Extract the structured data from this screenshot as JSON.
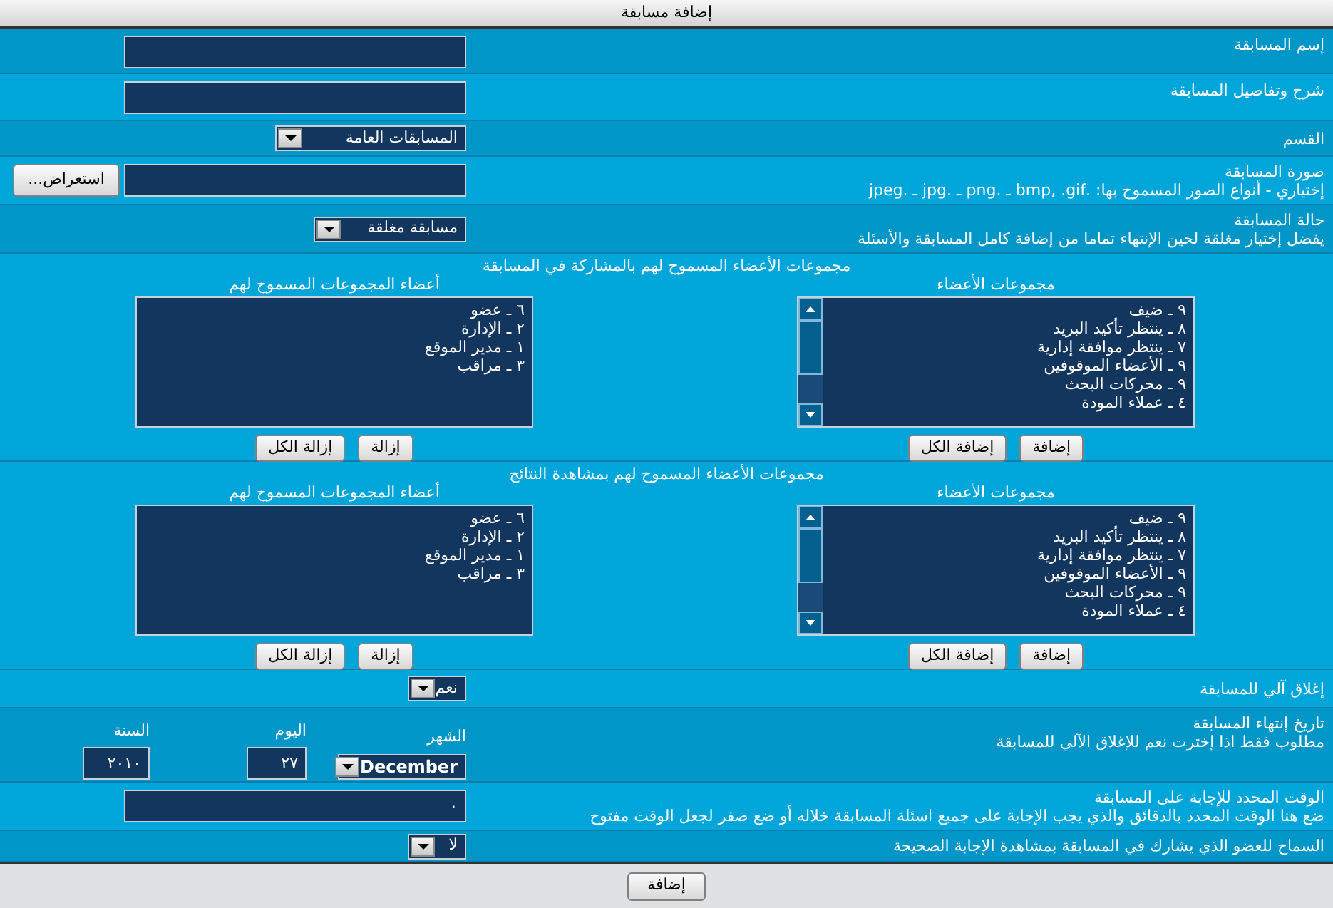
{
  "window": {
    "title": "إضافة مسابقة"
  },
  "name_field": {
    "label": "إسم المسابقة"
  },
  "description_field": {
    "label": "شرح وتفاصيل المسابقة"
  },
  "category": {
    "label": "القسم",
    "value": "المسابقات العامة"
  },
  "image": {
    "label": "صورة المسابقة",
    "hint": "إختياري - أنواع الصور المسموح بها: .bmp, .gif ـ .png ـ .jpg ـ .jpeg",
    "button": "استعراض..."
  },
  "status": {
    "label": "حالة المسابقة",
    "hint": "يفضل إختيار مغلقة لحين الإنتهاء تماما من إضافة كامل المسابقة والأسئلة",
    "value": "مسابقة مغلقة"
  },
  "group_sections": [
    {
      "title": "مجموعات الأعضاء المسموح لهم بالمشاركة في المسابقة",
      "available_title": "مجموعات الأعضاء",
      "available": [
        "٩ ـ ضيف",
        "٨ ـ ينتظر تأكيد البريد",
        "٧ ـ ينتظر موافقة إدارية",
        "٩ ـ الأعضاء الموقوفين",
        "٩ ـ محركات البحث",
        "٤ ـ عملاء المودة"
      ],
      "add_buttons": [
        "إضافة",
        "إضافة الكل"
      ],
      "selected_title": "أعضاء المجموعات المسموح لهم",
      "selected": [
        "٦ ـ عضو",
        "٢ ـ الإدارة",
        "١ ـ مدير الموقع",
        "٣ ـ مراقب"
      ],
      "remove_buttons": [
        "إزالة",
        "إزالة الكل"
      ]
    },
    {
      "title": "مجموعات الأعضاء المسموح لهم بمشاهدة النتائج",
      "available_title": "مجموعات الأعضاء",
      "available": [
        "٩ ـ ضيف",
        "٨ ـ ينتظر تأكيد البريد",
        "٧ ـ ينتظر موافقة إدارية",
        "٩ ـ الأعضاء الموقوفين",
        "٩ ـ محركات البحث",
        "٤ ـ عملاء المودة"
      ],
      "add_buttons": [
        "إضافة",
        "إضافة الكل"
      ],
      "selected_title": "أعضاء المجموعات المسموح لهم",
      "selected": [
        "٦ ـ عضو",
        "٢ ـ الإدارة",
        "١ ـ مدير الموقع",
        "٣ ـ مراقب"
      ],
      "remove_buttons": [
        "إزالة",
        "إزالة الكل"
      ]
    }
  ],
  "auto_close": {
    "label": "إغلاق آلي للمسابقة",
    "value": "نعم"
  },
  "end_date": {
    "label": "تاريخ إنتهاء المسابقة",
    "hint": "مطلوب فقط اذا إخترت نعم للإغلاق الآلي للمسابقة",
    "month_label": "الشهر",
    "month": "December",
    "day_label": "اليوم",
    "day": "٢٧",
    "year_label": "السنة",
    "year": "٢٠١٠"
  },
  "time_limit": {
    "label": "الوقت المحدد للإجابة على المسابقة",
    "hint": "ضع هنا الوقت المحدد بالدقائق والذي يجب الإجابة على جميع اسئلة المسابقة خلاله أو ضع صفر لجعل الوقت مفتوح",
    "value": "٠"
  },
  "show_answer": {
    "label": "السماح للعضو الذي يشارك في المسابقة بمشاهدة الإجابة الصحيحة",
    "value": "لا"
  },
  "submit": "إضافة"
}
